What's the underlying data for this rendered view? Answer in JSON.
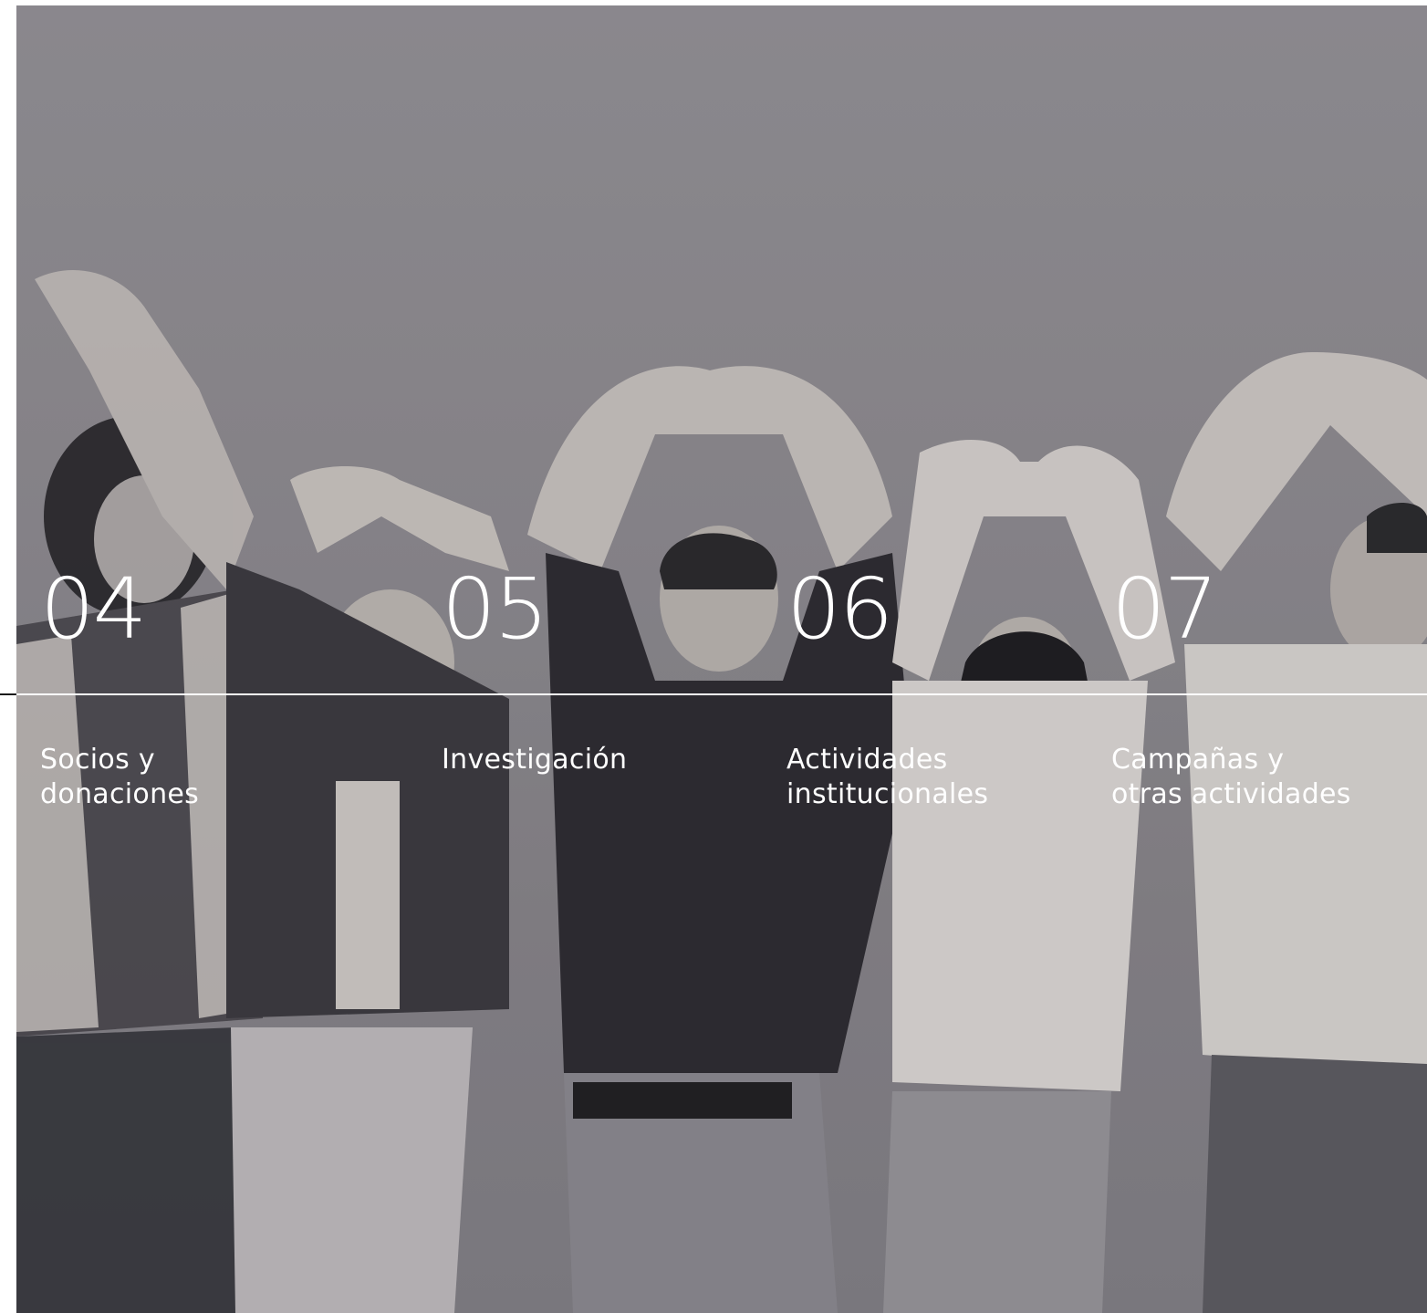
{
  "sections": [
    {
      "number": "04",
      "label_line1": "Socios y",
      "label_line2": "donaciones"
    },
    {
      "number": "05",
      "label_line1": "Investigación",
      "label_line2": ""
    },
    {
      "number": "06",
      "label_line1": "Actividades",
      "label_line2": "institucionales"
    },
    {
      "number": "07",
      "label_line1": "Campañas y",
      "label_line2": "otras actividades"
    }
  ],
  "colors": {
    "background_photo": "#918e94",
    "text": "#ffffff",
    "rule": "#ffffff"
  },
  "photo": {
    "description_icon": "people-making-heart-hands-photo"
  }
}
